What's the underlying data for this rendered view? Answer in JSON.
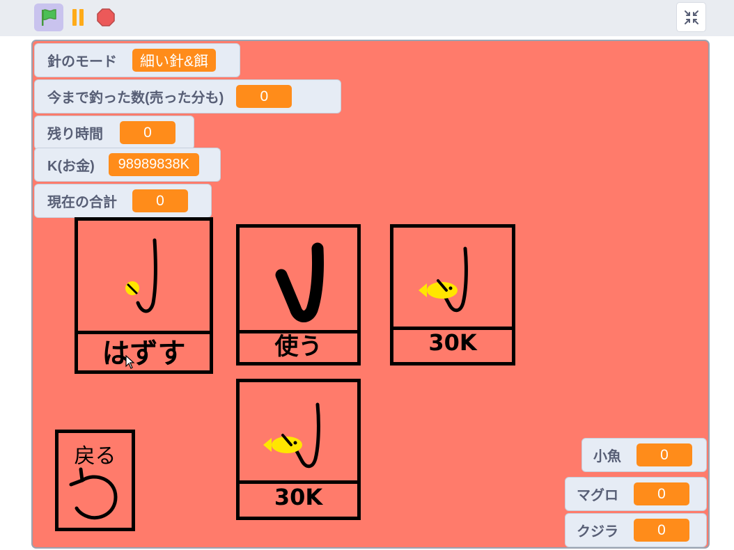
{
  "toolbar": {
    "flag_icon": "green-flag-icon",
    "pause_icon": "pause-icon",
    "stop_icon": "stop-icon",
    "fullscreen_icon": "exit-fullscreen-icon"
  },
  "colors": {
    "stage_bg": "#ff7b6b",
    "monitor_value": "#ff8c1a",
    "flag_active": "#c9c3ee",
    "fish": "#ffe600"
  },
  "monitors": {
    "hook_mode": {
      "label": "針のモード",
      "value": "細い針&餌"
    },
    "caught_total": {
      "label": "今まで釣った数(売った分も)",
      "value": "0"
    },
    "time_left": {
      "label": "残り時間",
      "value": "0"
    },
    "money": {
      "label": "K(お金)",
      "value": "98989838K"
    },
    "current_total": {
      "label": "現在の合計",
      "value": "0"
    },
    "small_fish": {
      "label": "小魚",
      "value": "0"
    },
    "tuna": {
      "label": "マグロ",
      "value": "0"
    },
    "whale": {
      "label": "クジラ",
      "value": "0"
    }
  },
  "cards": {
    "remove": {
      "label": "はずす",
      "icon": "thin-hook-with-bait-icon"
    },
    "use": {
      "label": "使う",
      "icon": "thick-hook-icon"
    },
    "buy_fish_hook_1": {
      "label": "30K",
      "icon": "hook-with-fish-icon"
    },
    "buy_fish_hook_2": {
      "label": "30K",
      "icon": "hook-with-fish-icon"
    }
  },
  "back": {
    "label": "戻る",
    "icon": "return-arrow-icon"
  }
}
